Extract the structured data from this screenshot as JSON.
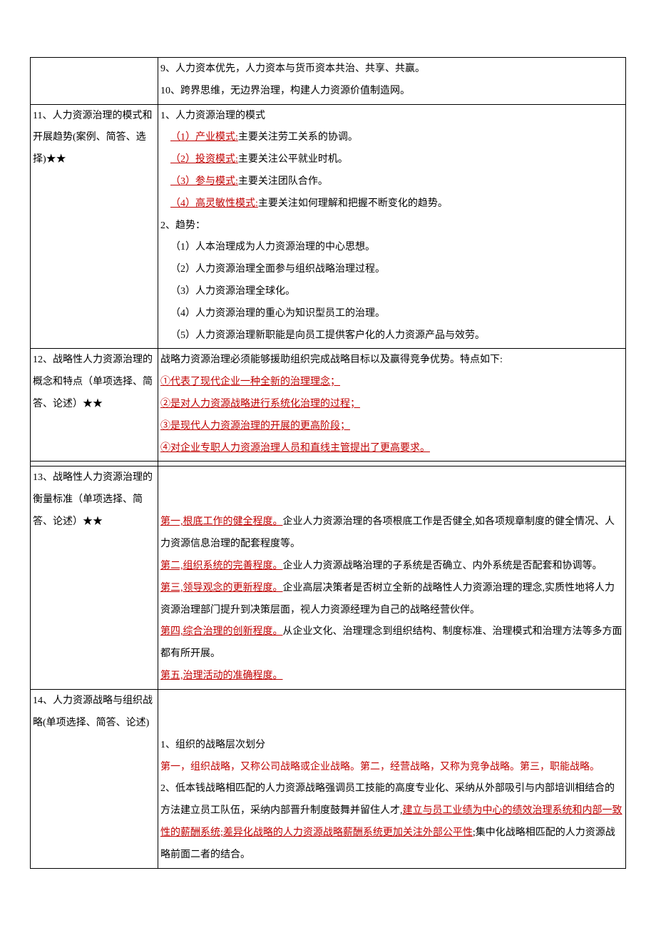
{
  "row0": {
    "left": "",
    "right": {
      "l1": "9、人力资本优先，人力资本与货币资本共治、共享、共赢。",
      "l2": "10、跨界思维，无边界治理，构建人力资源价值制造网。"
    }
  },
  "row11": {
    "left": "11、人力资源治理的模式和开展趋势(案例、简答、选择)★★",
    "right": {
      "h1": "1、人力资源治理的模式",
      "m1a": "（1）产业模式:",
      "m1b": "主要关注劳工关系的协调。",
      "m2a": "（2）投资模式:",
      "m2b": "主要关注公平就业时机。",
      "m3a": "（3）参与模式:",
      "m3b": "主要关注团队合作。",
      "m4a": "（4）高灵敏性模式:",
      "m4b": "主要关注如何理解和把握不断变化的趋势。",
      "h2": "2、趋势：",
      "t1": "（1）人本治理成为人力资源治理的中心思想。",
      "t2": "（2）人力资源治理全面参与组织战略治理过程。",
      "t3": "（3）人力资源治理全球化。",
      "t4": "（4）人力资源治理的重心为知识型员工的治理。",
      "t5": "（5）人力资源治理新职能是向员工提供客户化的人力资源产品与效劳。"
    }
  },
  "row12": {
    "left": "12、战略性人力资源治理的概念和特点（单项选择、简答、论述）★★",
    "right": {
      "intro": "战略力资源治理必须能够援助组织完成战略目标以及赢得竞争优势。特点如下:",
      "p1": "①代表了现代企业一种全新的治理理念；",
      "p2": "②是对人力资源战略进行系统化治理的过程；",
      "p3": "③是现代人力资源治理的开展的更高阶段；",
      "p4": "④对企业专职人力资源治理人员和直线主管提出了更高要求。"
    }
  },
  "rowEmpty": {
    "left": "",
    "right": ""
  },
  "row13": {
    "left": "13、战略性人力资源治理的衡量标准（单项选择、简答、论述）★★",
    "right": {
      "a1a": "第一,根底工作的健全程度。",
      "a1b": "企业人力资源治理的各项根底工作是否健全,如各项规章制度的健全情况、人力资源信息治理的配套程度等。",
      "a2a": "第二,组织系统的完善程度。",
      "a2b": "企业人力资源战略治理的子系统是否确立、内外系统是否配套和协调等。",
      "a3a": "第三,领导观念的更新程度。",
      "a3b": "企业高层决策者是否树立全新的战略性人力资源治理的理念,实质性地将人力资源治理部门提升到决策层面，视人力资源经理为自己的战略经营伙伴。",
      "a4a": "第四,综合治理的创新程度。",
      "a4b": "从企业文化、治理理念到组织结构、制度标准、治理模式和治理方法等多方面都有所开展。",
      "a5a": "第五,治理活动的准确程度。"
    }
  },
  "row14": {
    "left": "14、人力资源战略与组织战略(单项选择、简答、论述)",
    "right": {
      "h1": "1、组织的战略层次划分",
      "l1a": "第一，组织战略，又称公司战略或企业战略。第二，经营战略，又称为竞争战略。第三，职能战略。",
      "h2a": "2、低本钱战略相匹配的人力资源战略强调员工技能的高度专业化、采纳从外部吸引与内部培训相结合的方法建立员工队伍，采纳内部晋升制度鼓舞并留住人才,",
      "h2b": "建立与员工业绩为中心的绩效治理系统和内部一致性的薪酬系统;差异化战略的人力资源战略薪酬系统更加关注外部公平性",
      "h2c": ";集中化战略相匹配的人力资源战略前面二者的结合。"
    }
  }
}
